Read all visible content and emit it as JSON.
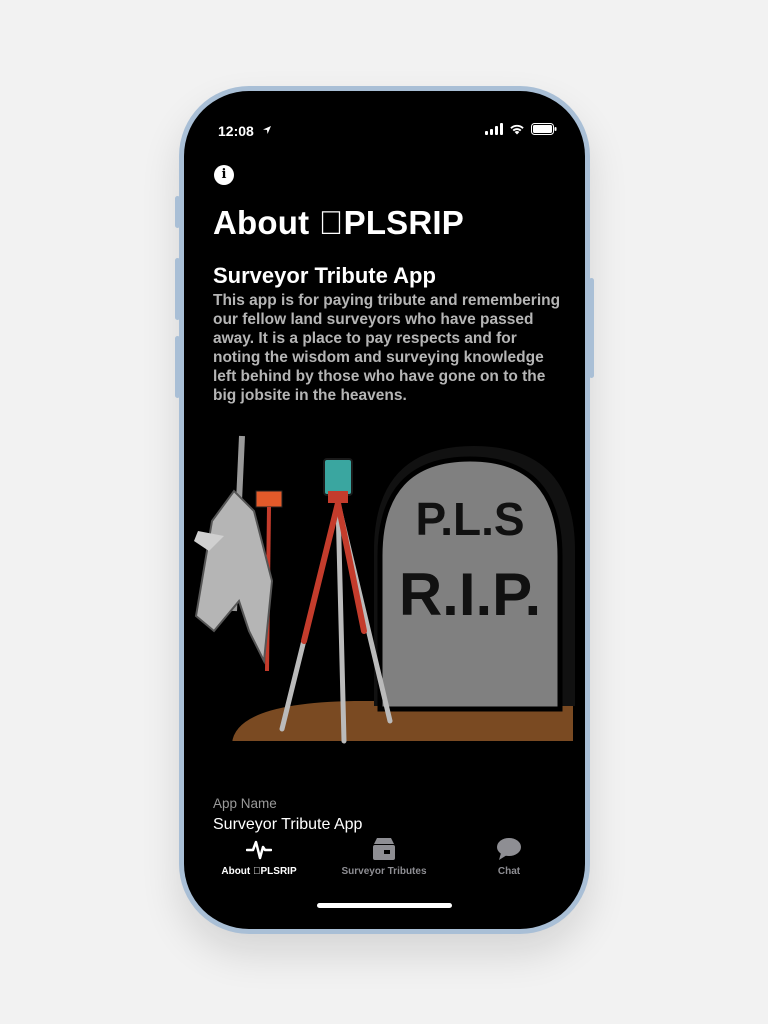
{
  "status_bar": {
    "time": "12:08"
  },
  "page": {
    "title": "About PLSRIP",
    "subtitle": "Surveyor Tribute App",
    "description": "This app is for paying tribute and remembering our fellow land surveyors who have passed away. It is a place to pay respects and for noting the wisdom and surveying knowledge left behind by those who have gone on to the big jobsite in the heavens."
  },
  "artwork": {
    "headstone_line1": "P.L.S",
    "headstone_line2": "R.I.P."
  },
  "details": {
    "app_name_label": "App Name",
    "app_name_value": "Surveyor Tribute App"
  },
  "tabs": [
    {
      "label": "About PLSRIP",
      "icon": "activity-pulse-icon",
      "active": true
    },
    {
      "label": "Surveyor Tributes",
      "icon": "archive-box-icon",
      "active": false
    },
    {
      "label": "Chat",
      "icon": "chat-bubble-icon",
      "active": false
    }
  ],
  "colors": {
    "background": "#000000",
    "active_tab": "#ffffff",
    "inactive_tab": "#8e8e93",
    "frame": "#a9bfd6",
    "headstone": "#808080",
    "dirt": "#7a4a22"
  }
}
